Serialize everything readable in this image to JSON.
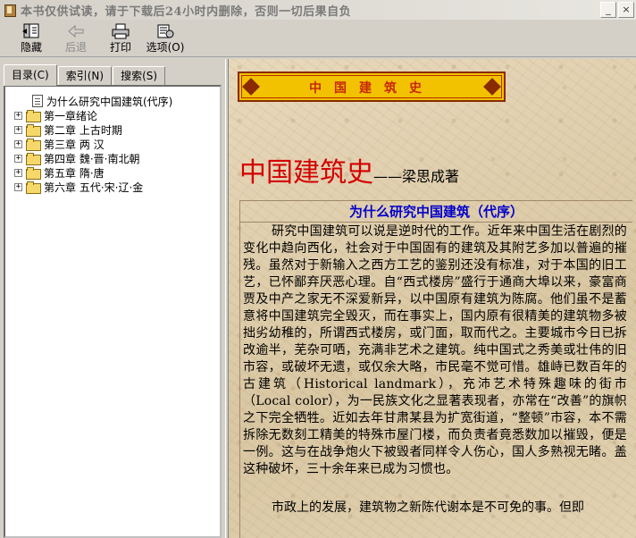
{
  "window": {
    "title": "本书仅供试读，请于下载后24小时内删除，否则一切后果自负",
    "minimize": "_",
    "close": "×"
  },
  "toolbar": {
    "hide_label": "隐藏",
    "back_label": "后退",
    "print_label": "打印",
    "options_label": "选项(O)"
  },
  "tabs": [
    {
      "label": "目录(C)"
    },
    {
      "label": "索引(N)"
    },
    {
      "label": "搜索(S)"
    }
  ],
  "tree": {
    "preface": "为什么研究中国建筑(代序)",
    "chapters": [
      "第一章绪论",
      "第二章 上古时期",
      "第三章 两 汉",
      "第四章 魏·晋·南北朝",
      "第五章 隋·唐",
      "第六章 五代·宋·辽·金"
    ],
    "expander": "+"
  },
  "content": {
    "banner": "中国建筑史",
    "title": "中国建筑史",
    "dash": "——",
    "author": "梁思成著",
    "subtitle": "为什么研究中国建筑（代序）",
    "paragraph1": "研究中国建筑可以说是逆时代的工作。近年来中国生活在剧烈的变化中趋向西化，社会对于中国固有的建筑及其附艺多加以普遍的摧残。虽然对于新输入之西方工艺的鉴别还没有标准，对于本国的旧工艺，已怀鄙弃厌恶心理。自“西式楼房”盛行于通商大埠以来，豪富商贾及中产之家无不深爱新异，以中国原有建筑为陈腐。他们虽不是蓄意将中国建筑完全毁灭，而在事实上，国内原有很精美的建筑物多被拙劣幼稚的，所谓西式楼房，或门面，取而代之。主要城市今日已拆改逾半，芜杂可哂，充满非艺术之建筑。纯中国式之秀美或壮伟的旧市容，或破坏无遗，或仅余大略，市民毫不觉可惜。雄峙已数百年的古建筑（Historical landmark），充沛艺术特殊趣味的街市（Local color），为一民族文化之显著表现者，亦常在“改善”的旗帜之下完全牺牲。近如去年甘肃某县为扩宽街道，“整顿”市容，本不需拆除无数刻工精美的特殊市屋门楼，而负责者竟悉数加以摧毁，便是一例。这与在战争炮火下被毁者同样令人伤心，国人多熟视无睹。盖这种破坏，三十余年来已成为习惯也。",
    "paragraph2": "市政上的发展，建筑物之新陈代谢本是不可免的事。但即"
  }
}
